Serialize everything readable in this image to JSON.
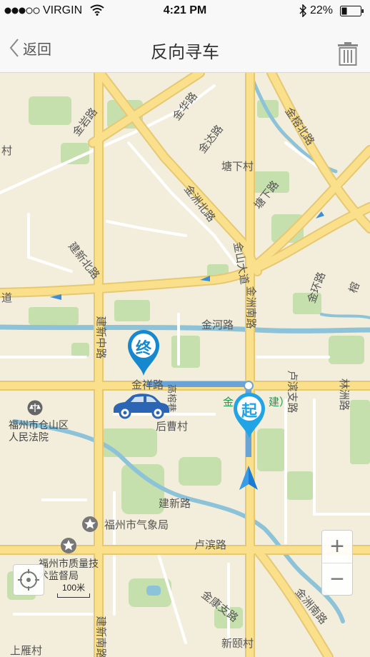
{
  "status_bar": {
    "carrier": "VIRGIN",
    "time": "4:21 PM",
    "battery": "22%",
    "signal_icon": "signal-dots-icon",
    "wifi_icon": "wifi-icon",
    "bluetooth_icon": "bluetooth-icon"
  },
  "nav": {
    "back_label": "返回",
    "title": "反向寻车",
    "trash_icon": "trash-icon"
  },
  "map": {
    "labels": {
      "jinyan": "金岩路",
      "jinhua": "金华路",
      "jinda": "金达路",
      "jinrong_north": "金榕北路",
      "tangxia": "塘下村",
      "jinzhou_north": "金洲北路",
      "tangxia_road": "塘下路",
      "jianxin_north": "建新北路",
      "jinshan_avenue": "金山大道",
      "jinzhou_south_1": "金洲南路",
      "jinhuan": "金环路",
      "jinhe": "金河路",
      "jianxin_middle": "建新中路",
      "jinxiang": "金祥路",
      "gaoyao": "高榕巷",
      "luling": "卢滨支路",
      "linchuan": "林洲路",
      "houcao": "后曹村",
      "court": "福州市仓山区人民法院",
      "jianxin_road": "建新路",
      "weather": "福州市气象局",
      "lubin": "卢滨路",
      "quality": "福州市质量技术监督局",
      "jinkang": "金康支路",
      "jinzhou_south_2": "金洲南路",
      "xinqi": "新颐村",
      "shangyan": "上雁村",
      "jianxin_south": "建新南路",
      "green_jin": "金",
      "green_jian": "建）",
      "cun_edge": "村",
      "dao_edge": "道",
      "mu": "榕"
    },
    "pins": {
      "end_label": "终",
      "start_label": "起"
    },
    "scale_label": "100米",
    "zoom_in": "+",
    "zoom_out": "−",
    "colors": {
      "pin_blue": "#1688d0",
      "start_blue": "#21a4e6",
      "route": "#6aa4d6",
      "car": "#2c65b4",
      "water": "#8cc3d9",
      "park": "#c6e0ad",
      "road": "#fbe08c"
    }
  }
}
